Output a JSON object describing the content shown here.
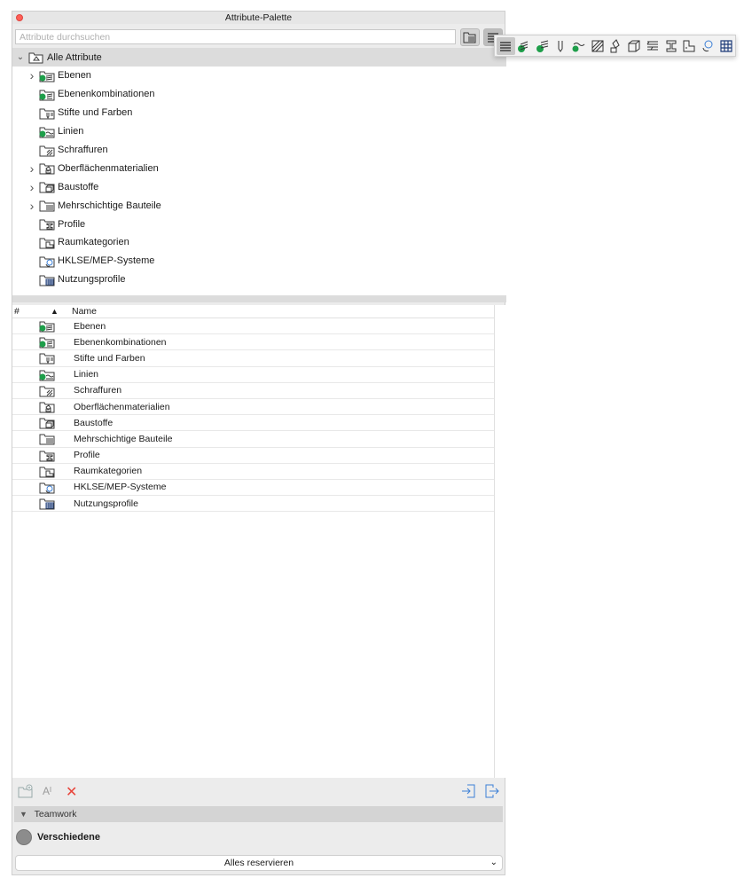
{
  "window": {
    "title": "Attribute-Palette"
  },
  "search": {
    "placeholder": "Attribute durchsuchen"
  },
  "tree": {
    "root_label": "Alle Attribute",
    "items": [
      {
        "label": "Ebenen",
        "expandable": true,
        "icon": "layers-icon"
      },
      {
        "label": "Ebenenkombinationen",
        "expandable": false,
        "icon": "layer-combinations-icon"
      },
      {
        "label": "Stifte und Farben",
        "expandable": false,
        "icon": "pens-colors-icon"
      },
      {
        "label": "Linien",
        "expandable": false,
        "icon": "lines-icon"
      },
      {
        "label": "Schraffuren",
        "expandable": false,
        "icon": "fills-icon"
      },
      {
        "label": "Oberflächenmaterialien",
        "expandable": true,
        "icon": "surfaces-icon"
      },
      {
        "label": "Baustoffe",
        "expandable": true,
        "icon": "building-materials-icon"
      },
      {
        "label": "Mehrschichtige Bauteile",
        "expandable": true,
        "icon": "composites-icon"
      },
      {
        "label": "Profile",
        "expandable": false,
        "icon": "profiles-icon"
      },
      {
        "label": "Raumkategorien",
        "expandable": false,
        "icon": "zone-categories-icon"
      },
      {
        "label": "HKLSE/MEP-Systeme",
        "expandable": false,
        "icon": "mep-systems-icon"
      },
      {
        "label": "Nutzungsprofile",
        "expandable": false,
        "icon": "operation-profiles-icon"
      }
    ]
  },
  "list": {
    "columns": {
      "number": "#",
      "sort": "▲",
      "name": "Name"
    },
    "rows": [
      {
        "name": "Ebenen"
      },
      {
        "name": "Ebenenkombinationen"
      },
      {
        "name": "Stifte und Farben"
      },
      {
        "name": "Linien"
      },
      {
        "name": "Schraffuren"
      },
      {
        "name": "Oberflächenmaterialien"
      },
      {
        "name": "Baustoffe"
      },
      {
        "name": "Mehrschichtige Bauteile"
      },
      {
        "name": "Profile"
      },
      {
        "name": "Raumkategorien"
      },
      {
        "name": "HKLSE/MEP-Systeme"
      },
      {
        "name": "Nutzungsprofile"
      }
    ]
  },
  "teamwork": {
    "section_label": "Teamwork",
    "status_label": "Verschiedene",
    "reserve_label": "Alles reservieren"
  },
  "colors": {
    "accent_green": "#1e9e4a",
    "close_red": "#fe5f57",
    "icon_stroke": "#3a3a3a",
    "delete_red": "#e8443a",
    "link_blue": "#3b7fd6"
  }
}
